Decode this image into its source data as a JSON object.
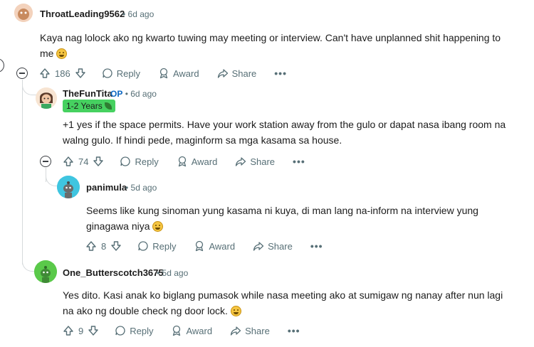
{
  "comments": [
    {
      "username": "ThroatLeading9562",
      "time": "6d ago",
      "body_line1": "Kaya nag lolock ako ng kwarto tuwing may meeting or interview. Can't have unplanned shit happening to",
      "body_line2": "me",
      "votes": "186",
      "avatar_color": "#c88a5e"
    },
    {
      "username": "TheFunTita",
      "op_label": "OP",
      "time": "6d ago",
      "flair": "1-2 Years",
      "body_line1": "+1 yes if the space permits. Have your work station away from the gulo or dapat nasa ibang room na",
      "body_line2": "walng gulo. If hindi pede, maginform sa mga kasama sa house.",
      "votes": "74",
      "avatar_color": "#f1c6a5"
    },
    {
      "username": "panimula",
      "time": "5d ago",
      "body_line1": "Seems like kung sinoman yung kasama ni kuya, di man lang na-inform na interview yung",
      "body_line2": "ginagawa niya",
      "votes": "8",
      "avatar_color": "#3fc5e0"
    },
    {
      "username": "One_Butterscotch3675",
      "time": "5d ago",
      "body_line1": "Yes dito. Kasi anak ko biglang pumasok while nasa meeting ako at sumigaw ng nanay after nun lagi",
      "body_line2": "na ako ng double check ng door lock.",
      "votes": "9",
      "avatar_color": "#5ac94a"
    }
  ],
  "actions": {
    "reply": "Reply",
    "award": "Award",
    "share": "Share",
    "more": "•••"
  },
  "separator": "•"
}
